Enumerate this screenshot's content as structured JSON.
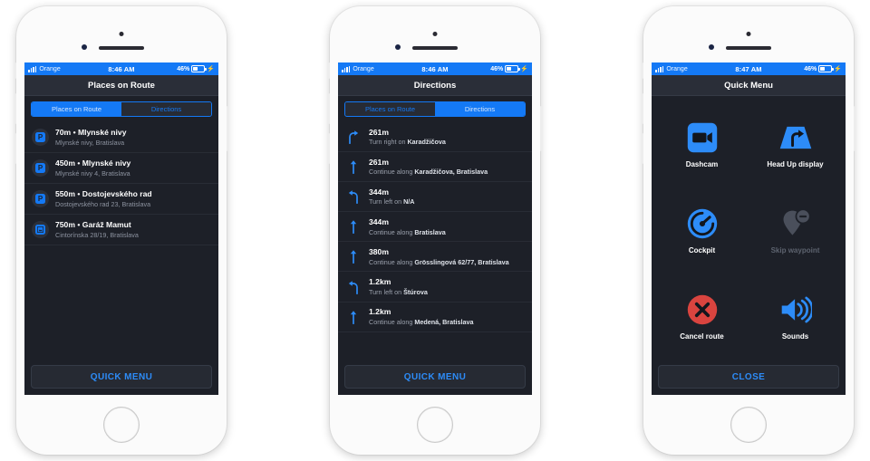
{
  "colors": {
    "accent": "#1479f5",
    "screen_bg": "#1d2028",
    "header_bg": "#2a2e38",
    "danger": "#d9443f",
    "muted": "#5d636f"
  },
  "status_bar": {
    "carrier": "Orange",
    "time_1": "8:46 AM",
    "time_2": "8:46 AM",
    "time_3": "8:47 AM",
    "battery": "46%",
    "signal_icon": "signal-bars-icon",
    "battery_icon": "battery-icon",
    "charging_icon": "charging-bolt-icon"
  },
  "phone1": {
    "header_title": "Places on Route",
    "tabs": [
      {
        "label": "Places on Route",
        "active": true
      },
      {
        "label": "Directions",
        "active": false
      }
    ],
    "places": [
      {
        "icon": "parking-icon",
        "glyph": "P",
        "title": "70m • Mlynské nivy",
        "subtitle": "Mlynské nivy, Bratislava"
      },
      {
        "icon": "parking-icon",
        "glyph": "P",
        "title": "450m • Mlynské nivy",
        "subtitle": "Mlynské nivy 4, Bratislava"
      },
      {
        "icon": "parking-icon",
        "glyph": "P",
        "title": "550m • Dostojevského rad",
        "subtitle": "Dostojevského rad 23, Bratislava"
      },
      {
        "icon": "garage-icon",
        "glyph": "",
        "title": "750m • Garáž Mamut",
        "subtitle": "Cintorínska 28/19, Bratislava"
      }
    ],
    "footer_button": "QUICK MENU"
  },
  "phone2": {
    "header_title": "Directions",
    "tabs": [
      {
        "label": "Places on Route",
        "active": false
      },
      {
        "label": "Directions",
        "active": true
      }
    ],
    "directions": [
      {
        "icon": "turn-right-icon",
        "distance": "261m",
        "instruction_prefix": "Turn right on ",
        "instruction_road": "Karadžičova"
      },
      {
        "icon": "continue-straight-icon",
        "distance": "261m",
        "instruction_prefix": "Continue along ",
        "instruction_road": "Karadžičova, Bratislava"
      },
      {
        "icon": "turn-left-icon",
        "distance": "344m",
        "instruction_prefix": "Turn left on ",
        "instruction_road": "N/A"
      },
      {
        "icon": "continue-straight-icon",
        "distance": "344m",
        "instruction_prefix": "Continue along ",
        "instruction_road": "Bratislava"
      },
      {
        "icon": "continue-straight-icon",
        "distance": "380m",
        "instruction_prefix": "Continue along ",
        "instruction_road": "Grösslingová 62/77, Bratislava"
      },
      {
        "icon": "turn-left-icon",
        "distance": "1.2km",
        "instruction_prefix": "Turn left on ",
        "instruction_road": "Štúrova"
      },
      {
        "icon": "continue-straight-icon",
        "distance": "1.2km",
        "instruction_prefix": "Continue along ",
        "instruction_road": "Medená, Bratislava"
      }
    ],
    "footer_button": "QUICK MENU"
  },
  "phone3": {
    "header_title": "Quick Menu",
    "items": [
      {
        "icon": "dashcam-icon",
        "label": "Dashcam",
        "disabled": false
      },
      {
        "icon": "head-up-display-icon",
        "label": "Head Up display",
        "disabled": false
      },
      {
        "icon": "cockpit-icon",
        "label": "Cockpit",
        "disabled": false
      },
      {
        "icon": "skip-waypoint-icon",
        "label": "Skip waypoint",
        "disabled": true
      },
      {
        "icon": "cancel-route-icon",
        "label": "Cancel route",
        "disabled": false
      },
      {
        "icon": "sounds-icon",
        "label": "Sounds",
        "disabled": false
      }
    ],
    "footer_button": "CLOSE"
  }
}
